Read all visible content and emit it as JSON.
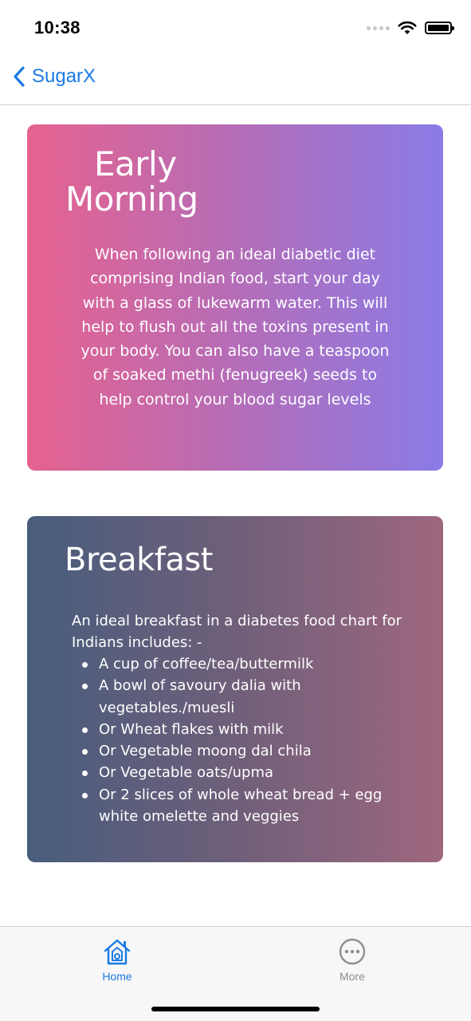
{
  "status_bar": {
    "time": "10:38"
  },
  "nav": {
    "back_label": "SugarX"
  },
  "cards": {
    "morning": {
      "title_line1": "Early",
      "title_line2": "Morning",
      "body": "When following an ideal diabetic diet comprising Indian food, start your day with a glass of lukewarm water. This will help to flush out all the toxins present in your body. You can also have a teaspoon of soaked methi (fenugreek) seeds to help control your blood sugar levels"
    },
    "breakfast": {
      "title": "Breakfast",
      "intro": "An ideal breakfast in a diabetes food chart for Indians includes: -",
      "items": [
        "A cup of coffee/tea/buttermilk",
        "A bowl of savoury dalia with vegetables./muesli",
        "Or Wheat flakes with milk",
        "Or Vegetable moong dal chila",
        "Or Vegetable oats/upma",
        "Or 2 slices of whole wheat bread + egg white omelette and veggies"
      ]
    }
  },
  "tabs": [
    {
      "label": "Home",
      "icon": "home-icon",
      "selected": true
    },
    {
      "label": "More",
      "icon": "more-icon",
      "selected": false
    }
  ],
  "colors": {
    "accent": "#1a7ae6",
    "tab_inactive": "#8e8e93",
    "morning_gradient": [
      "#e6628f",
      "#8a7be6"
    ],
    "breakfast_gradient": [
      "#485d7d",
      "#9e677e"
    ]
  }
}
